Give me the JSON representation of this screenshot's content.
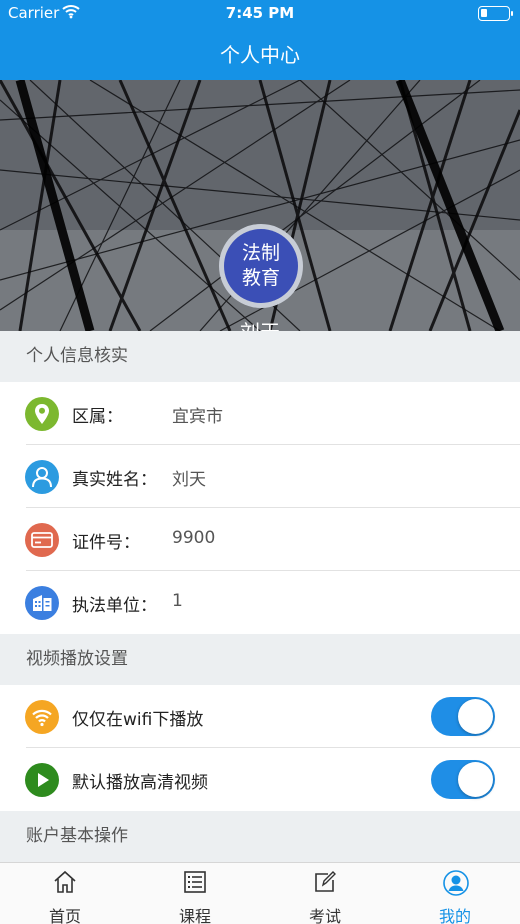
{
  "status_bar": {
    "carrier": "Carrier",
    "time": "7:45 PM"
  },
  "nav": {
    "title": "个人中心"
  },
  "profile": {
    "avatar_line1": "法制",
    "avatar_line2": "教育",
    "name": "刘天"
  },
  "sections": {
    "personal_info": "个人信息核实",
    "video_settings": "视频播放设置",
    "account_ops": "账户基本操作"
  },
  "info_rows": [
    {
      "label": "区属：",
      "value": "宜宾市",
      "icon": "location-icon",
      "color": "#7cb82f"
    },
    {
      "label": "真实姓名：",
      "value": "刘天",
      "icon": "person-icon",
      "color": "#2c9be0"
    },
    {
      "label": "证件号：",
      "value": "9900",
      "icon": "id-card-icon",
      "color": "#e0694f"
    },
    {
      "label": "执法单位：",
      "value": "1",
      "icon": "building-icon",
      "color": "#3b7fe0"
    }
  ],
  "video_rows": [
    {
      "label": "仅仅在wifi下播放",
      "icon": "wifi-icon",
      "color": "#f5a623",
      "enabled": true
    },
    {
      "label": "默认播放高清视频",
      "icon": "play-icon",
      "color": "#2e8b1e",
      "enabled": true
    }
  ],
  "tabs": [
    {
      "label": "首页",
      "icon": "home-icon",
      "active": false
    },
    {
      "label": "课程",
      "icon": "list-icon",
      "active": false
    },
    {
      "label": "考试",
      "icon": "edit-icon",
      "active": false
    },
    {
      "label": "我的",
      "icon": "user-icon",
      "active": true
    }
  ],
  "colors": {
    "accent": "#1592e6",
    "toggle_on": "#1f8ee6",
    "avatar_bg": "#3b4fb6"
  }
}
